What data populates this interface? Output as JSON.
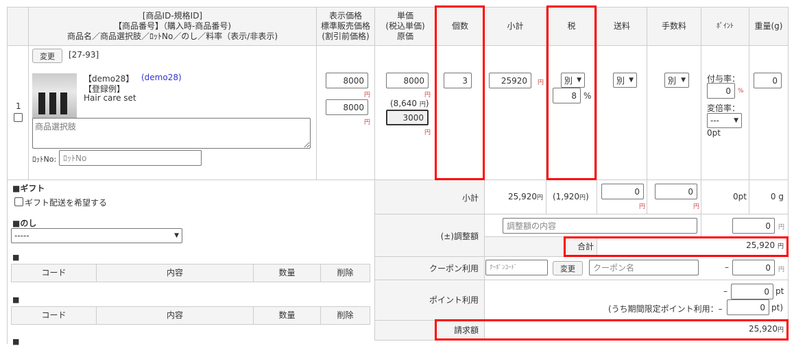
{
  "header": {
    "col_line": "",
    "col_product": [
      "[商品ID-規格ID]",
      "【商品番号】（購入時-商品番号)",
      "商品名／商品選択肢／ﾛｯﾄNo／のし／料率（表示/非表示)"
    ],
    "col_price": [
      "表示価格",
      "標準販売価格",
      "(割引前価格)"
    ],
    "col_unit": [
      "単価",
      "(税込単価)",
      "原価"
    ],
    "col_qty": "個数",
    "col_subtotal": "小計",
    "col_tax": "税",
    "col_shipping": "送料",
    "col_fee": "手数料",
    "col_point": "ﾎﾟｲﾝﾄ",
    "col_weight": "重量(g)"
  },
  "item": {
    "line_no": "1",
    "change_label": "変更",
    "id": "[27-93]",
    "code": "【demo28】",
    "code_link": "(demo28)",
    "category": "【登録例】",
    "name": "Hair care set",
    "option_placeholder": "商品選択肢",
    "lot_label": "ﾛｯﾄNo:",
    "lot_placeholder": "ﾛｯﾄNo",
    "display_price": "8000",
    "standard_price": "8000",
    "unit_price": "8000",
    "unit_price_tax": "(8,640",
    "cost": "3000",
    "yen": "円",
    "qty": "3",
    "subtotal": "25920",
    "tax_type": "別",
    "tax_rate": "8",
    "percent": "%",
    "shipping_type": "別",
    "fee_type": "別",
    "point_rate_label": "付与率：",
    "point_rate": "0",
    "multiplier_label": "変倍率：",
    "multiplier": "---",
    "points": "0pt",
    "weight": "0"
  },
  "gift": {
    "title": "■ギフト",
    "checkbox_label": "ギフト配送を希望する",
    "noshi_title": "■のし",
    "noshi_value": "-----",
    "table_title": "■",
    "columns": [
      "コード",
      "内容",
      "数量",
      "削除"
    ]
  },
  "summary": {
    "subtotal_label": "小計",
    "subtotal": "25,920",
    "tax": "(1,920",
    "tax_close": ")",
    "shipping": "0",
    "fee": "0",
    "points": "0pt",
    "weight": "0 g",
    "adjust_label": "(±)調整額",
    "adjust_placeholder": "調整額の内容",
    "adjust": "0",
    "total_label": "合計",
    "total": "25,920",
    "coupon_label": "クーポン利用",
    "coupon_code_placeholder": "ｸｰﾎﾟﾝｺｰﾄﾞ",
    "coupon_change": "変更",
    "coupon_name_placeholder": "クーポン名",
    "coupon": "0",
    "minus": "–",
    "point_label": "ポイント利用",
    "point_use": "0",
    "pt": "pt",
    "limited_label": "(うち期間限定ポイント利用：–",
    "limited": "0",
    "pt_close": "pt)",
    "billing_label": "請求額",
    "billing": "25,920"
  }
}
